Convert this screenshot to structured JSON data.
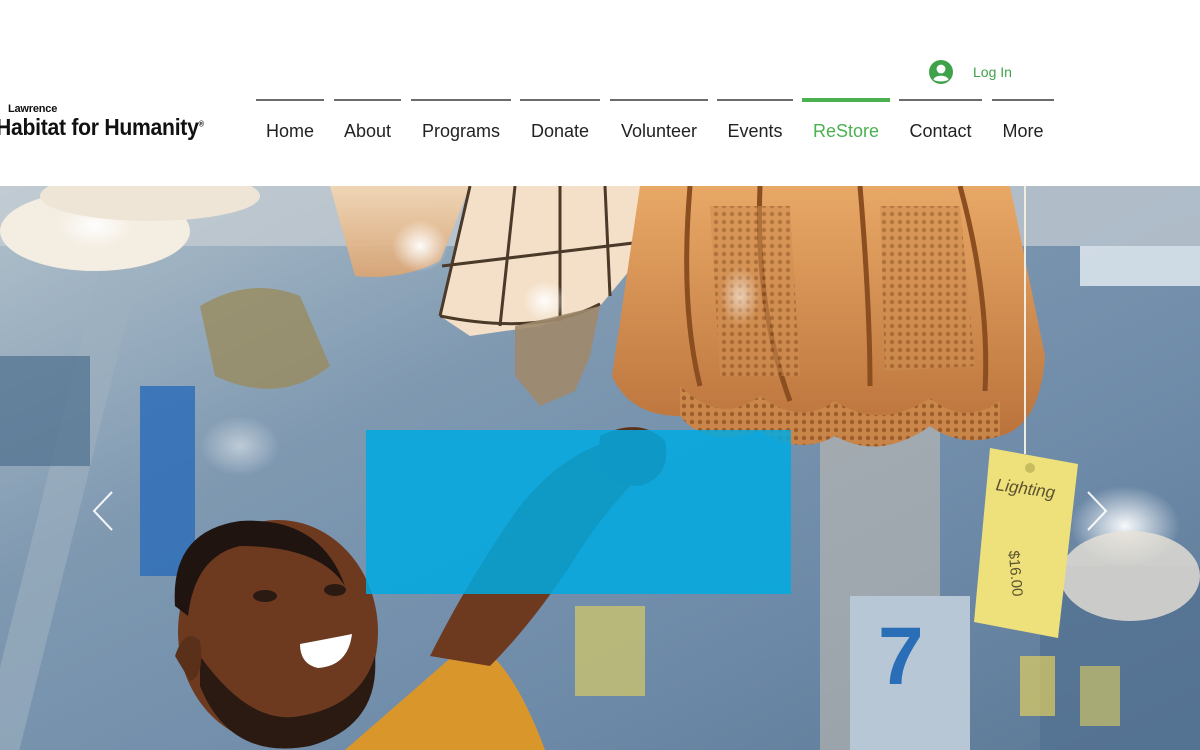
{
  "brand": {
    "logo_small": "Lawrence",
    "logo_main": "Habitat for Humanity",
    "logo_mark": "®"
  },
  "login": {
    "label": "Log In",
    "icon": "user-avatar-icon"
  },
  "nav": {
    "items": [
      {
        "label": "Home"
      },
      {
        "label": "About"
      },
      {
        "label": "Programs"
      },
      {
        "label": "Donate"
      },
      {
        "label": "Volunteer"
      },
      {
        "label": "Events"
      },
      {
        "label": "ReStore",
        "active": true
      },
      {
        "label": "Contact"
      },
      {
        "label": "More"
      }
    ]
  },
  "hero": {
    "tag_text": "Lighting",
    "tag_price": "$16.00",
    "bin_number": "7"
  },
  "colors": {
    "accent": "#4bb04f",
    "login_text": "#3fa24a",
    "caption_box": "#00aae2",
    "nav_text": "#222222"
  }
}
